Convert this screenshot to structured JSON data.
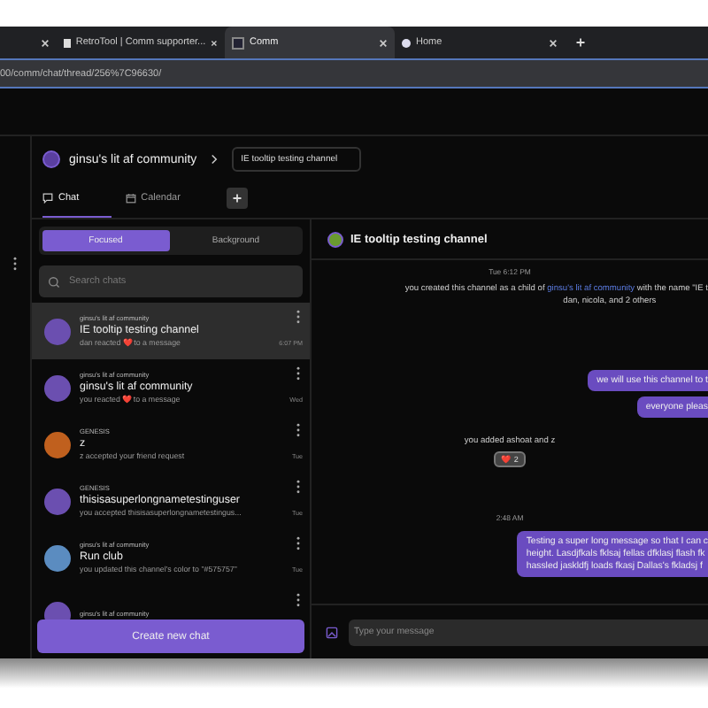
{
  "browser": {
    "tabs": [
      {
        "selected": false
      },
      {
        "label": "RetroTool | Comm supporter...",
        "selected": false
      },
      {
        "label": "Comm",
        "selected": true
      },
      {
        "label": "Home",
        "selected": false
      }
    ],
    "url": "00/comm/chat/thread/256%7C96630/"
  },
  "community": {
    "name": "ginsu's lit af community",
    "breadcrumb": "IE tooltip testing channel"
  },
  "nav_tabs": [
    {
      "label": "Chat",
      "selected": true
    },
    {
      "label": "Calendar",
      "selected": false
    }
  ],
  "segments": [
    {
      "label": "Focused",
      "selected": true
    },
    {
      "label": "Background",
      "selected": false
    }
  ],
  "search": {
    "placeholder": "Search chats"
  },
  "chats": [
    {
      "community": "ginsu's lit af community",
      "title": "IE tooltip testing channel",
      "preview": "dan reacted ❤️ to a message",
      "time": "6:07 PM",
      "selected": true,
      "color": "#6b4fb0"
    },
    {
      "community": "ginsu's lit af community",
      "title": "ginsu's lit af community",
      "preview": "you reacted ❤️ to a message",
      "time": "Wed",
      "selected": false,
      "color": "#6b4fb0"
    },
    {
      "community": "GENESIS",
      "title": "z",
      "preview": "z accepted your friend request",
      "time": "Tue",
      "selected": false,
      "color": "#c0601e"
    },
    {
      "community": "GENESIS",
      "title": "thisisasuperlongnametestinguser",
      "preview": "you accepted thisisasuperlongnametestingus...",
      "time": "Tue",
      "selected": false,
      "color": "#6b4fb0"
    },
    {
      "community": "ginsu's lit af community",
      "title": "Run club",
      "preview": "you updated this channel's color to \"#575757\"",
      "time": "Tue",
      "selected": false,
      "color": "#5b8cc0"
    },
    {
      "community": "ginsu's lit af community",
      "selected": false,
      "color": "#6b4fb0"
    }
  ],
  "create_button": "Create new chat",
  "thread": {
    "title": "IE tooltip testing channel",
    "items": [
      {
        "kind": "time",
        "text": "Tue 6:12 PM"
      },
      {
        "kind": "notice",
        "before": "you created this channel as a child of ",
        "link": "ginsu's lit af community",
        "after": " with the name \"IE t",
        "line2": "dan, nicola, and 2 others"
      },
      {
        "kind": "bubble",
        "lines": [
          "we will use this channel to t"
        ]
      },
      {
        "kind": "bubble",
        "lines": [
          "everyone pleas"
        ]
      },
      {
        "kind": "system",
        "text": "you added ashoat and z",
        "reaction": "❤️ 2"
      },
      {
        "kind": "time",
        "text": "2:48 AM"
      },
      {
        "kind": "bubble",
        "lines": [
          "Testing a super long message so that I can c",
          "height. Lasdjfkals fklsaj fellas dfklasj flash fk",
          "hassled jaskldfj loads fkasj Dallas's fkladsj f"
        ]
      }
    ],
    "composer_placeholder": "Type your message"
  }
}
